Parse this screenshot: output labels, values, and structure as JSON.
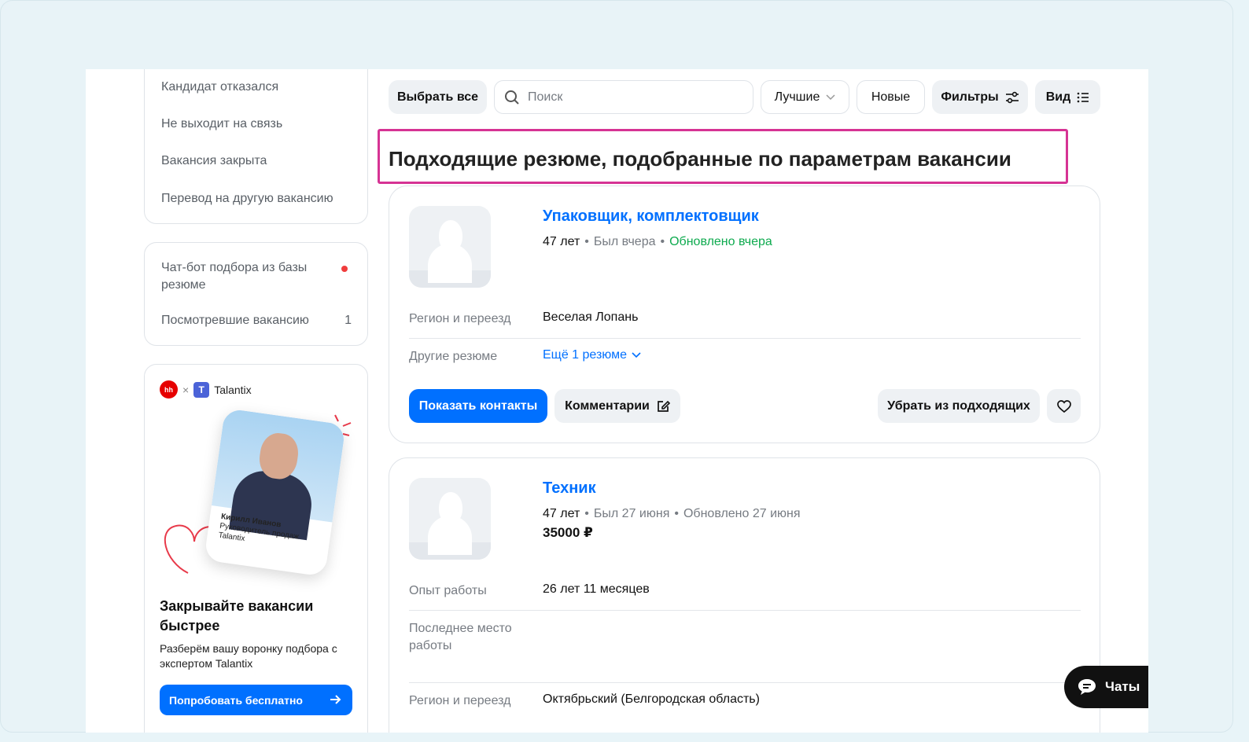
{
  "sidebar": {
    "statuses": [
      "Кандидат отказался",
      "Не выходит на связь",
      "Вакансия закрыта",
      "Перевод на другую вакансию"
    ],
    "extra": {
      "chatbot_label": "Чат-бот подбора из базы резюме",
      "viewed_label": "Посмотревшие вакансию",
      "viewed_count": "1"
    },
    "promo": {
      "hh_logo": "hh",
      "times": "×",
      "talantix_logo": "T",
      "talantix": "Talantix",
      "person_name": "Кирилл Иванов",
      "person_role": "Руководитель продаж",
      "person_company": "Talantix",
      "title": "Закрывайте вакансии быстрее",
      "desc": "Разберём вашу воронку подбора с экспертом Talantix",
      "button": "Попробовать бесплатно"
    }
  },
  "toolbar": {
    "select_all": "Выбрать все",
    "search_placeholder": "Поиск",
    "sort": "Лучшие",
    "new": "Новые",
    "filters": "Фильтры",
    "view": "Вид"
  },
  "heading": "Подходящие резюме, подобранные по параметрам вакансии",
  "resumes": [
    {
      "title": "Упаковщик, комплектовщик",
      "age": "47 лет",
      "seen": "Был вчера",
      "updated": "Обновлено вчера",
      "region_label": "Регион и переезд",
      "region": "Веселая Лопань",
      "other_label": "Другие резюме",
      "other": "Ещё 1 резюме",
      "show_contacts": "Показать контакты",
      "comments": "Комментарии",
      "remove": "Убрать из подходящих"
    },
    {
      "title": "Техник",
      "age": "47 лет",
      "seen": "Был 27 июня",
      "updated": "Обновлено 27 июня",
      "salary": "35000 ₽",
      "exp_label": "Опыт работы",
      "exp": "26 лет 11 месяцев",
      "last_label": "Последнее место работы",
      "region_label": "Регион и переезд",
      "region": "Октябрьский (Белгородская область)"
    }
  ],
  "chats": "Чаты"
}
